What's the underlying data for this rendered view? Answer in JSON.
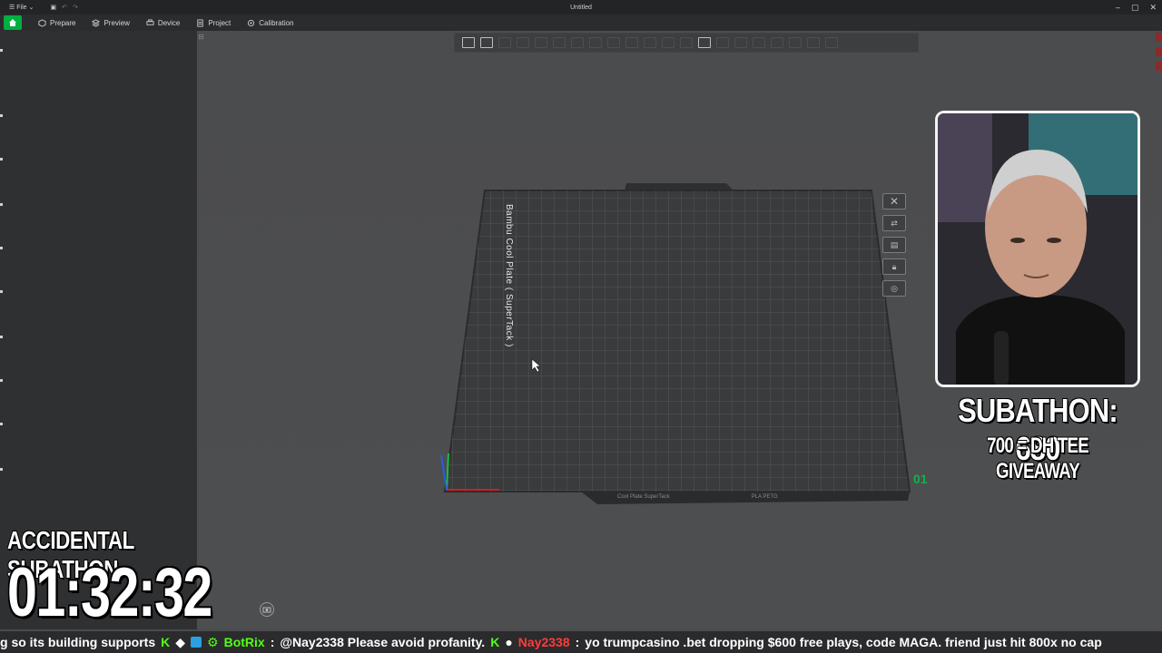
{
  "window": {
    "title": "Untitled",
    "file_menu": "File"
  },
  "nav_tabs": [
    {
      "label": "Prepare",
      "icon": "cube-icon"
    },
    {
      "label": "Preview",
      "icon": "layers-icon"
    },
    {
      "label": "Device",
      "icon": "printer-icon"
    },
    {
      "label": "Project",
      "icon": "document-icon"
    },
    {
      "label": "Calibration",
      "icon": "target-icon"
    }
  ],
  "plate": {
    "name_label": "Bambu Cool Plate ( SuperTack )",
    "number": "01",
    "strip_plate": "Cool Plate SuperTack",
    "strip_filament": "PLA PETG"
  },
  "overlay": {
    "subathon_counter": "SUBATHON: 680",
    "subathon_goal": "700 = DH TEE GIVEAWAY",
    "accidental_title": "ACCIDENTAL SUBATHON",
    "timer": "01:32:32"
  },
  "ticker": {
    "part1": "g so its building supports",
    "user_botrix": "BotRix",
    "msg_botrix": "@Nay2338 Please avoid profanity.",
    "user_nay": "Nay2338",
    "msg_nay": "yo trumpcasino .bet dropping $600 free plays, code MAGA. friend just hit 800x no cap"
  },
  "colors": {
    "accent": "#00ae42",
    "panel": "#2f3032",
    "viewport": "#4b4c4e",
    "plate": "#3a3b3d"
  }
}
